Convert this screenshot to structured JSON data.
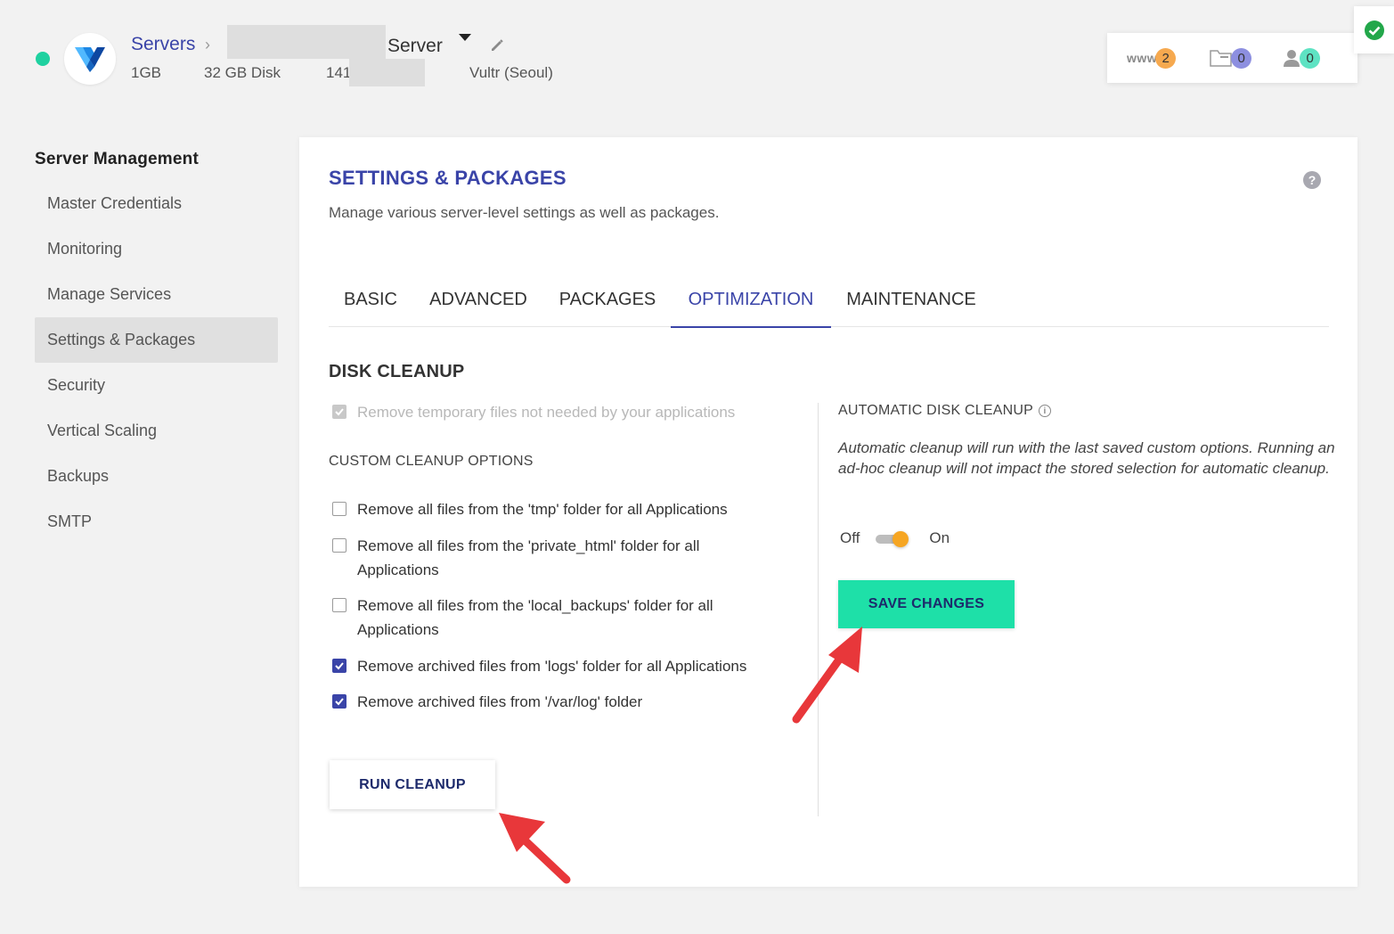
{
  "header": {
    "breadcrumb_root": "Servers",
    "server_name": "Server",
    "ram": "1GB",
    "disk": "32 GB Disk",
    "ip_prefix": "141.",
    "location": "Vultr (Seoul)",
    "counters": {
      "www_label": "www",
      "www_count": "2",
      "files_count": "0",
      "users_count": "0"
    }
  },
  "sidebar": {
    "title": "Server Management",
    "items": [
      {
        "label": "Master Credentials"
      },
      {
        "label": "Monitoring"
      },
      {
        "label": "Manage Services"
      },
      {
        "label": "Settings & Packages"
      },
      {
        "label": "Security"
      },
      {
        "label": "Vertical Scaling"
      },
      {
        "label": "Backups"
      },
      {
        "label": "SMTP"
      }
    ]
  },
  "main": {
    "title": "SETTINGS & PACKAGES",
    "subtitle": "Manage various server-level settings as well as packages.",
    "help": "?",
    "tabs": [
      {
        "label": "BASIC"
      },
      {
        "label": "ADVANCED"
      },
      {
        "label": "PACKAGES"
      },
      {
        "label": "OPTIMIZATION"
      },
      {
        "label": "MAINTENANCE"
      }
    ],
    "disk_cleanup": {
      "title": "DISK CLEANUP",
      "temp_files_label": "Remove temporary files not needed by your applications",
      "custom_options_label": "CUSTOM CLEANUP OPTIONS",
      "options": [
        {
          "label": "Remove all files from the 'tmp' folder for all Applications",
          "checked": false
        },
        {
          "label": "Remove all files from the 'private_html' folder for all Applications",
          "checked": false
        },
        {
          "label": "Remove all files from the 'local_backups' folder for all Applications",
          "checked": false
        },
        {
          "label": "Remove archived files from 'logs' folder for all Applications",
          "checked": true
        },
        {
          "label": "Remove archived files from '/var/log' folder",
          "checked": true
        }
      ],
      "run_button": "RUN CLEANUP"
    },
    "auto_cleanup": {
      "title": "AUTOMATIC DISK CLEANUP",
      "info": "i",
      "description": "Automatic cleanup will run with the last saved custom options. Running an ad-hoc cleanup will not impact the stored selection for automatic cleanup.",
      "toggle_off": "Off",
      "toggle_on": "On",
      "toggle_state": "on",
      "save_button": "SAVE CHANGES"
    }
  },
  "colors": {
    "accent": "#3a44a8",
    "save_button": "#1ee0a8",
    "toggle_knob": "#f6a623",
    "annotation_arrow": "#e8373a"
  }
}
